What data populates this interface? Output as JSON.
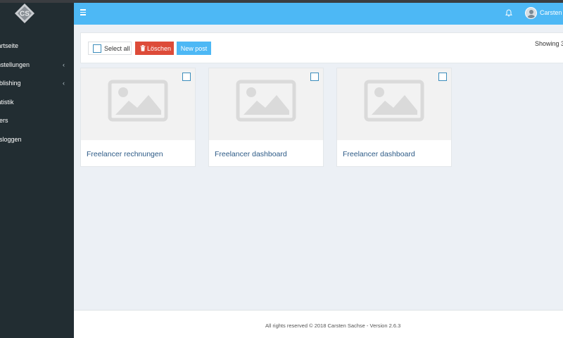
{
  "brand": {
    "logo_text": "CS",
    "logo_color": "#8a9096"
  },
  "colors": {
    "sidebar": "#222d32",
    "header": "#4db8f5",
    "danger": "#dd4b39",
    "link": "#2c5a86"
  },
  "sidebar": {
    "items": [
      {
        "label": "Startseite",
        "icon": "home-icon",
        "has_submenu": false
      },
      {
        "label": "Einstellungen",
        "icon": "settings-icon",
        "has_submenu": true
      },
      {
        "label": "Publishing",
        "icon": "publishing-icon",
        "has_submenu": true
      },
      {
        "label": "Statistik",
        "icon": "chart-icon",
        "has_submenu": false
      },
      {
        "label": "Users",
        "icon": "users-icon",
        "has_submenu": false
      },
      {
        "label": "Ausloggen",
        "icon": "logout-icon",
        "has_submenu": false
      }
    ],
    "chevron": "‹"
  },
  "header": {
    "menu_icon": "hamburger-icon",
    "bell_icon": "bell-icon",
    "user_name": "Carsten Sachse"
  },
  "toolbar": {
    "select_all_label": "Select all",
    "delete_label": "Löschen",
    "delete_icon": "trash-icon",
    "new_post_label": "New post",
    "showing_text": "Showing 3"
  },
  "posts": [
    {
      "title": "Freelancer rechnungen",
      "image_icon": "image-placeholder-icon"
    },
    {
      "title": "Freelancer dashboard",
      "image_icon": "image-placeholder-icon"
    },
    {
      "title": "Freelancer dashboard",
      "image_icon": "image-placeholder-icon"
    }
  ],
  "footer": {
    "text": "All rights reserved © 2018 Carsten Sachse - Version 2.6.3"
  }
}
